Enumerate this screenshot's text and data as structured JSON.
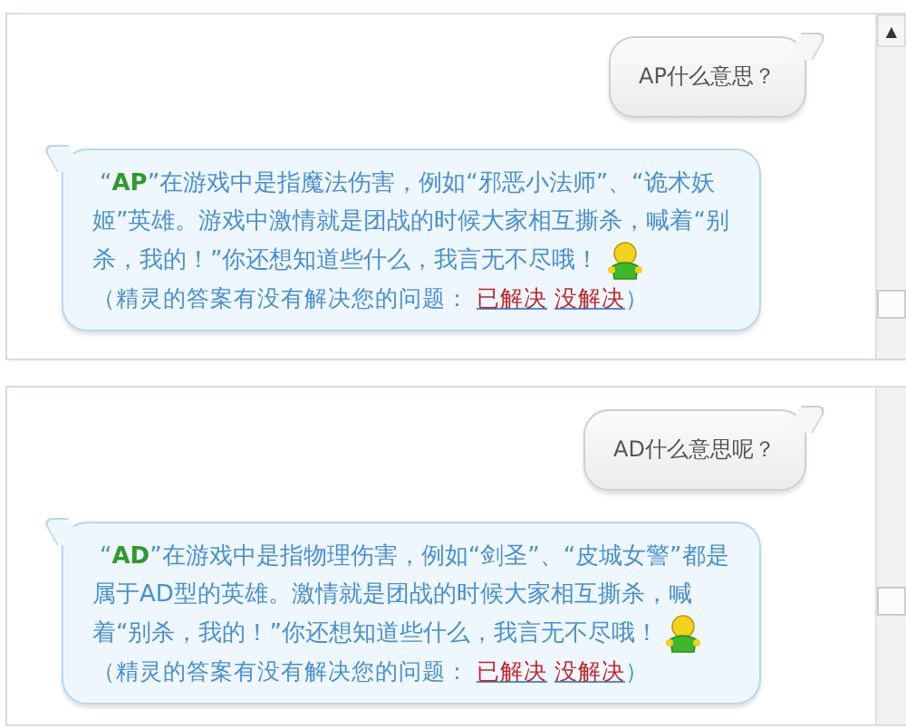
{
  "panels": [
    {
      "question": "AP什么意思？",
      "answer": "“**AP**”在游戏中是指魔法伤害，例如“邪恶小法师”、“诡术妖姬”英雄。游戏中激情就是团战的时候大家相互撕杀，喊着“别杀，我的！”你还想知道些什么，我言无不尽哦！",
      "feedback": {
        "prompt": "（精灵的答案有没有解决您的问题：",
        "links": [
          "已解决",
          "没解决"
        ],
        "suffix": "）"
      },
      "scroll_arrow": "▲"
    },
    {
      "question": "AD什么意思呢？",
      "answer": "“**AD**”在游戏中是指物理伤害，例如“剑圣”、“皮城女警”都是属于AD型的英雄。激情就是团战的时候大家相互撕杀，喊着“别杀，我的！”你还想知道些什么，我言无不尽哦！",
      "feedback": {
        "prompt": "（精灵的答案有没有解决您的问题：",
        "links": [
          "已解决",
          "没解决"
        ],
        "suffix": "）"
      }
    }
  ]
}
